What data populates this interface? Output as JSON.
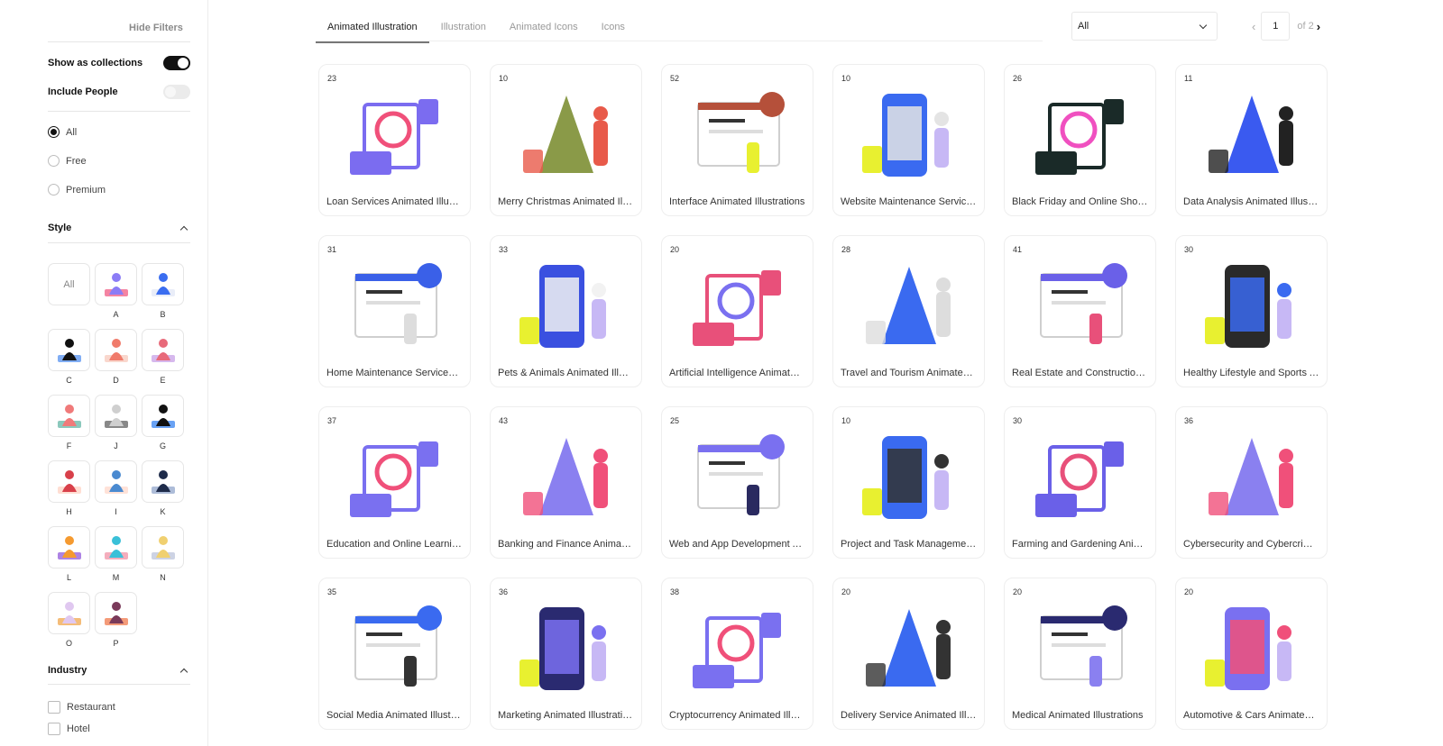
{
  "sidebar": {
    "hide_filters": "Hide Filters",
    "show_as_collections": {
      "label": "Show as collections",
      "on": true
    },
    "include_people": {
      "label": "Include People",
      "on": false
    },
    "pricing": [
      {
        "label": "All",
        "checked": true
      },
      {
        "label": "Free",
        "checked": false
      },
      {
        "label": "Premium",
        "checked": false
      }
    ],
    "style": {
      "title": "Style",
      "all_label": "All",
      "items": [
        {
          "letter": "A",
          "color": "#8b7cf6",
          "accent": "#f0507a"
        },
        {
          "letter": "B",
          "color": "#3a6df0",
          "accent": "#dfe6f5"
        },
        {
          "letter": "C",
          "color": "#111111",
          "accent": "#4a8af0"
        },
        {
          "letter": "D",
          "color": "#f07b6b",
          "accent": "#f7c6b8"
        },
        {
          "letter": "E",
          "color": "#e86a7a",
          "accent": "#c49ae6"
        },
        {
          "letter": "F",
          "color": "#f07a7a",
          "accent": "#5ab0a0"
        },
        {
          "letter": "J",
          "color": "#cfcfcf",
          "accent": "#555555"
        },
        {
          "letter": "G",
          "color": "#111111",
          "accent": "#2a7bf0"
        },
        {
          "letter": "H",
          "color": "#d8404a",
          "accent": "#ffd0c0"
        },
        {
          "letter": "I",
          "color": "#4a8ad0",
          "accent": "#ffd5c8"
        },
        {
          "letter": "K",
          "color": "#1e2b4a",
          "accent": "#8aa0c8"
        },
        {
          "letter": "L",
          "color": "#f59a30",
          "accent": "#8a4fd8"
        },
        {
          "letter": "M",
          "color": "#3ac0d8",
          "accent": "#f08aa0"
        },
        {
          "letter": "N",
          "color": "#f0d070",
          "accent": "#b8c0d8"
        },
        {
          "letter": "O",
          "color": "#e0c8f0",
          "accent": "#f0a040"
        },
        {
          "letter": "P",
          "color": "#7a3a5a",
          "accent": "#f07040"
        }
      ]
    },
    "industry": {
      "title": "Industry",
      "items": [
        {
          "label": "Restaurant",
          "checked": false
        },
        {
          "label": "Hotel",
          "checked": false
        }
      ]
    }
  },
  "tabs": [
    {
      "label": "Animated Illustration",
      "active": true
    },
    {
      "label": "Illustration",
      "active": false
    },
    {
      "label": "Animated Icons",
      "active": false
    },
    {
      "label": "Icons",
      "active": false
    }
  ],
  "filter_select": {
    "value": "All"
  },
  "pagination": {
    "current": "1",
    "of_label": "of 2"
  },
  "cards": [
    {
      "count": "23",
      "title": "Loan Services Animated Illustrations",
      "color": "#7b6cf0",
      "accent": "#f0507a"
    },
    {
      "count": "10",
      "title": "Merry Christmas Animated Illustrations",
      "color": "#8a9a48",
      "accent": "#e85a4a"
    },
    {
      "count": "52",
      "title": "Interface Animated Illustrations",
      "color": "#b5503a",
      "accent": "#e8f030"
    },
    {
      "count": "10",
      "title": "Website Maintenance Services Animated Illustrations",
      "color": "#3a6af0",
      "accent": "#e4e4e4"
    },
    {
      "count": "26",
      "title": "Black Friday and Online Shopping Animated Illustrations",
      "color": "#1a2a28",
      "accent": "#f050c0"
    },
    {
      "count": "11",
      "title": "Data Analysis Animated Illustrations",
      "color": "#3a5af0",
      "accent": "#222222"
    },
    {
      "count": "31",
      "title": "Home Maintenance Services Animated Illustrations",
      "color": "#3a60e8",
      "accent": "#dddddd"
    },
    {
      "count": "33",
      "title": "Pets & Animals Animated Illustrations",
      "color": "#3a50e0",
      "accent": "#f2f2f2"
    },
    {
      "count": "20",
      "title": "Artificial Intelligence Animated Illustrations",
      "color": "#e8507a",
      "accent": "#7a70f0"
    },
    {
      "count": "28",
      "title": "Travel and Tourism Animated Illustrations",
      "color": "#3a6af0",
      "accent": "#dddddd"
    },
    {
      "count": "41",
      "title": "Real Estate and Construction Animated Illustrations",
      "color": "#6a60e8",
      "accent": "#e8507a"
    },
    {
      "count": "30",
      "title": "Healthy Lifestyle and Sports Animated Illustrations",
      "color": "#2a2a2a",
      "accent": "#3a6af0"
    },
    {
      "count": "37",
      "title": "Education and Online Learning Animated Illustrations",
      "color": "#7a70f0",
      "accent": "#f0507a"
    },
    {
      "count": "43",
      "title": "Banking and Finance Animated Illustrations",
      "color": "#8a80f0",
      "accent": "#f0507a"
    },
    {
      "count": "25",
      "title": "Web and App Development Animated Illustrations",
      "color": "#7a70f0",
      "accent": "#2a2a60"
    },
    {
      "count": "10",
      "title": "Project and Task Management Animated Illustrations",
      "color": "#3a6af0",
      "accent": "#333333"
    },
    {
      "count": "30",
      "title": "Farming and Gardening Animated Illustrations",
      "color": "#6a60e8",
      "accent": "#e8507a"
    },
    {
      "count": "36",
      "title": "Cybersecurity and Cybercrime Animated Illustrations",
      "color": "#8a80f0",
      "accent": "#f0507a"
    },
    {
      "count": "35",
      "title": "Social Media Animated Illustrations",
      "color": "#3a6af0",
      "accent": "#333333"
    },
    {
      "count": "36",
      "title": "Marketing Animated Illustrations",
      "color": "#2a2a70",
      "accent": "#7a70f0"
    },
    {
      "count": "38",
      "title": "Cryptocurrency Animated Illustrations",
      "color": "#7a70f0",
      "accent": "#f0507a"
    },
    {
      "count": "20",
      "title": "Delivery Service Animated Illustrations",
      "color": "#3a6af0",
      "accent": "#333333"
    },
    {
      "count": "20",
      "title": "Medical Animated Illustrations",
      "color": "#2a2a70",
      "accent": "#8a80f0"
    },
    {
      "count": "20",
      "title": "Automotive & Cars Animated Illustrations",
      "color": "#7a70f0",
      "accent": "#f0507a"
    }
  ]
}
